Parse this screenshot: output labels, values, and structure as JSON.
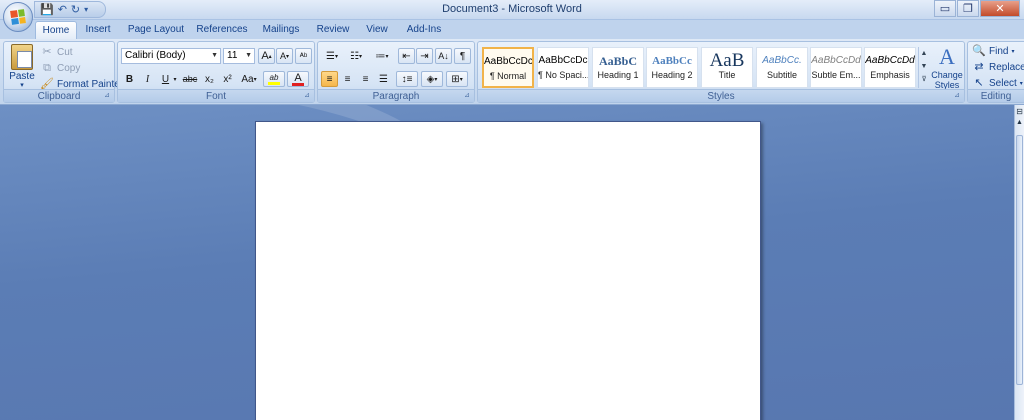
{
  "app": {
    "title": "Document3 - Microsoft Word"
  },
  "quick_access": {
    "save_icon": "save-icon",
    "undo_icon": "undo-icon",
    "redo_icon": "redo-icon"
  },
  "window_controls": {
    "minimize": "▭",
    "maximize": "❐",
    "close": "✕"
  },
  "tabs": [
    {
      "label": "Home",
      "active": true
    },
    {
      "label": "Insert"
    },
    {
      "label": "Page Layout"
    },
    {
      "label": "References"
    },
    {
      "label": "Mailings"
    },
    {
      "label": "Review"
    },
    {
      "label": "View"
    },
    {
      "label": "Add-Ins"
    }
  ],
  "clipboard": {
    "label": "Clipboard",
    "paste": "Paste",
    "cut": "Cut",
    "copy": "Copy",
    "format_painter": "Format Painter"
  },
  "font": {
    "label": "Font",
    "font_name": "Calibri (Body)",
    "font_size": "11",
    "bold": "B",
    "italic": "I",
    "underline": "U",
    "strikethrough": "abc",
    "subscript": "x₂",
    "superscript": "x²",
    "change_case": "Aa",
    "grow_font": "A",
    "shrink_font": "A",
    "highlight": "ab",
    "font_color": "A",
    "highlight_color": "#ffff00",
    "font_color_value": "#e02020"
  },
  "paragraph": {
    "label": "Paragraph",
    "show_marks": "¶"
  },
  "styles": {
    "label": "Styles",
    "items": [
      {
        "sample": "AaBbCcDc",
        "name": "¶ Normal",
        "selected": true
      },
      {
        "sample": "AaBbCcDc",
        "name": "¶ No Spaci..."
      },
      {
        "sample": "AaBbC",
        "name": "Heading 1"
      },
      {
        "sample": "AaBbCc",
        "name": "Heading 2"
      },
      {
        "sample": "AaB",
        "name": "Title"
      },
      {
        "sample": "AaBbCc.",
        "name": "Subtitle"
      },
      {
        "sample": "AaBbCcDd",
        "name": "Subtle Em..."
      },
      {
        "sample": "AaBbCcDd",
        "name": "Emphasis"
      }
    ],
    "change_styles": "Change",
    "change_styles_2": "Styles"
  },
  "editing": {
    "label": "Editing",
    "find": "Find",
    "replace": "Replace",
    "select": "Select"
  }
}
